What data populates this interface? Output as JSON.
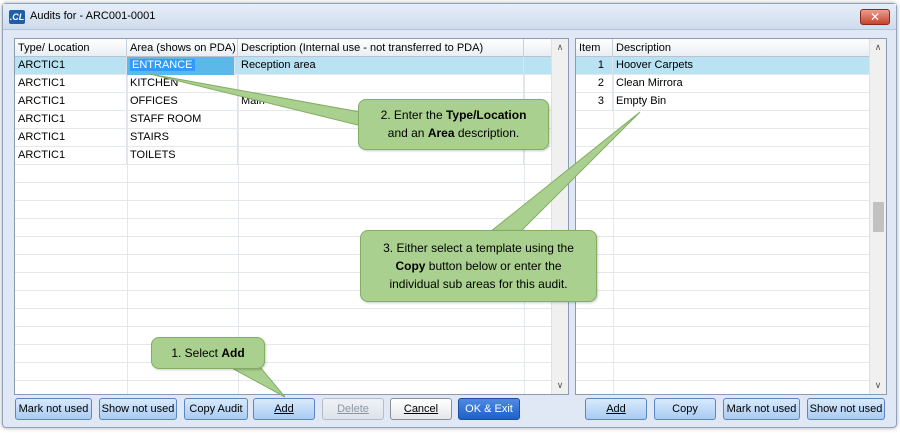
{
  "window": {
    "title": "Audits for - ARC001-0001",
    "app_icon": ".CL",
    "close_glyph": "✕"
  },
  "left_grid": {
    "headers": [
      "Type/ Location",
      "Area (shows on PDA)",
      "Description (Internal use - not transferred to PDA)"
    ],
    "rows": [
      {
        "type": "ARCTIC1",
        "area": "ENTRANCE",
        "desc": "Reception area"
      },
      {
        "type": "ARCTIC1",
        "area": "KITCHEN",
        "desc": ""
      },
      {
        "type": "ARCTIC1",
        "area": "OFFICES",
        "desc": "Main"
      },
      {
        "type": "ARCTIC1",
        "area": "STAFF ROOM",
        "desc": ""
      },
      {
        "type": "ARCTIC1",
        "area": "STAIRS",
        "desc": ""
      },
      {
        "type": "ARCTIC1",
        "area": "TOILETS",
        "desc": ""
      }
    ],
    "scroll_up": "∧",
    "scroll_down": "∨"
  },
  "right_grid": {
    "headers": [
      "Item",
      "Description"
    ],
    "rows": [
      {
        "item": "1",
        "desc": "Hoover Carpets"
      },
      {
        "item": "2",
        "desc": "Clean Mirrora"
      },
      {
        "item": "3",
        "desc": "Empty Bin"
      }
    ],
    "scroll_up": "∧",
    "scroll_down": "∨"
  },
  "left_buttons": {
    "mark_not_used": "Mark not used",
    "show_not_used": "Show not used",
    "copy_audit": "Copy Audit",
    "add": "Add",
    "delete": "Delete",
    "cancel": "Cancel",
    "ok_exit": "OK & Exit"
  },
  "right_buttons": {
    "add": "Add",
    "copy": "Copy",
    "mark_not_used": "Mark not used",
    "show_not_used": "Show not used"
  },
  "callouts": {
    "c1_prefix": "1. Select ",
    "c1_bold": "Add",
    "c2_line1_prefix": "2. Enter the ",
    "c2_line1_bold": "Type/Location",
    "c2_line2_prefix": "and an ",
    "c2_line2_bold": "Area",
    "c2_line2_suffix": " description.",
    "c3_line1": "3. Either select a template using the",
    "c3_line2_bold": "Copy",
    "c3_line2_suffix": " button below or enter the",
    "c3_line3": "individual sub areas for this audit."
  },
  "colors": {
    "callout_fill": "#a9d08e",
    "selected_row": "#b9e2f2",
    "button_blue": "#a9cbf2",
    "primary_button": "#1f5fc8"
  }
}
